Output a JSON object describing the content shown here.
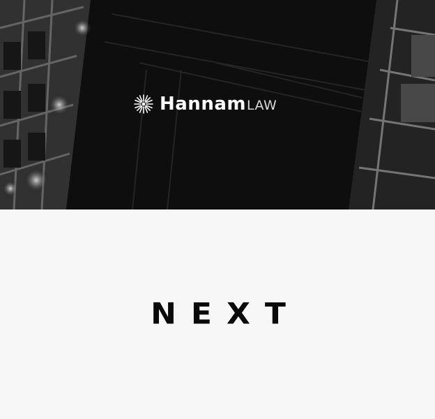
{
  "header": {
    "logo": {
      "name": "Hannam",
      "suffix": "LAW",
      "icon": "starburst-icon"
    },
    "background": "night-city-building-photo"
  },
  "main": {
    "next_label": "NEXT"
  },
  "colors": {
    "hero_bg": "#0b0b0b",
    "page_bg": "#f7f7f7",
    "text_dark": "#0a0a0a",
    "logo_text": "#ffffff"
  }
}
